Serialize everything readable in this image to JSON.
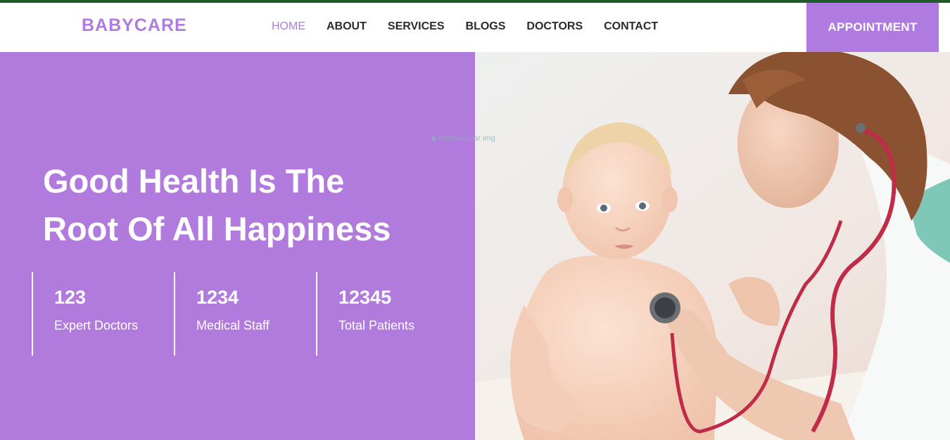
{
  "brand": {
    "name": "BABYCARE"
  },
  "nav": {
    "items": [
      {
        "label": "HOME",
        "active": true
      },
      {
        "label": "ABOUT",
        "active": false
      },
      {
        "label": "SERVICES",
        "active": false
      },
      {
        "label": "BLOGS",
        "active": false
      },
      {
        "label": "DOCTORS",
        "active": false
      },
      {
        "label": "CONTACT",
        "active": false
      }
    ],
    "appointment_label": "APPOINTMENT"
  },
  "hero": {
    "title_line1": "Good Health Is The",
    "title_line2": "Root Of All Happiness",
    "stats": [
      {
        "number": "123",
        "label": "Expert Doctors"
      },
      {
        "number": "1234",
        "label": "Medical Staff"
      },
      {
        "number": "12345",
        "label": "Total Patients"
      }
    ],
    "ghost_label": "Rectangular img"
  },
  "colors": {
    "accent": "#b07be0",
    "hero_bg": "#b07bdc",
    "top_border": "#1f5a2a"
  },
  "icons": {
    "ghost_marker": "dot-icon"
  }
}
